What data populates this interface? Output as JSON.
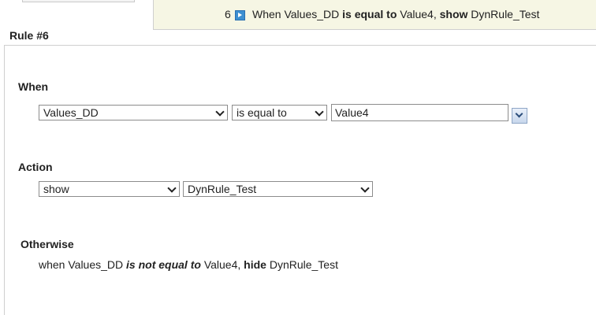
{
  "rule_row": {
    "number": "6",
    "summary": {
      "when": "When",
      "field": "Values_DD",
      "operator": "is equal to",
      "value": "Value4,",
      "action": "show",
      "target": "DynRule_Test"
    }
  },
  "rule_title": "Rule #6",
  "when_section": {
    "label": "When",
    "field_select": "Values_DD",
    "operator_select": "is equal to",
    "value_input": "Value4"
  },
  "action_section": {
    "label": "Action",
    "action_select": "show",
    "target_select": "DynRule_Test"
  },
  "otherwise_section": {
    "label": "Otherwise",
    "prefix": "when Values_DD",
    "operator": "is not equal to",
    "value": "Value4,",
    "action": "hide",
    "target": "DynRule_Test"
  },
  "colors": {
    "row_highlight": "#f6f6e4",
    "icon_blue": "#3d8fd1"
  }
}
